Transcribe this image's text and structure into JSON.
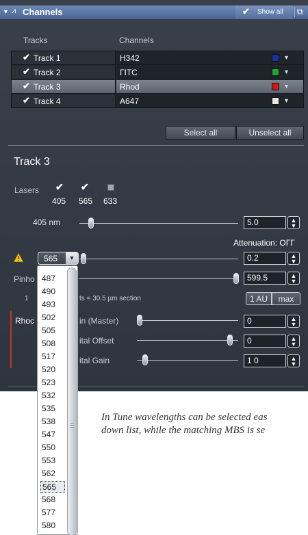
{
  "panel": {
    "title": "Channels",
    "show_all_label": "Show all"
  },
  "tracks_table": {
    "header_tracks": "Tracks",
    "header_channels": "Channels",
    "rows": [
      {
        "track": "Track 1",
        "channel": "H342",
        "color": "#1b2f9e",
        "selected": false
      },
      {
        "track": "Track 2",
        "channel": "ГITC",
        "color": "#1ca63a",
        "selected": false
      },
      {
        "track": "Track 3",
        "channel": "Rhod",
        "color": "#d11818",
        "selected": true
      },
      {
        "track": "Track 4",
        "channel": "A647",
        "color": "#e8e8e8",
        "selected": false
      }
    ]
  },
  "buttons": {
    "select_all": "Select all",
    "unselect_all": "Unselect all"
  },
  "track_section": {
    "title": "Track 3",
    "lasers_label": "Lasers",
    "lasers": [
      {
        "wavelength": "405",
        "checked": true
      },
      {
        "wavelength": "565",
        "checked": true
      },
      {
        "wavelength": "633",
        "checked": false
      }
    ],
    "laser_405_label": "405 nm",
    "laser_405_value": "5.0",
    "attenuation_text": "Attenuation: OГГ",
    "wavelength_combo_value": "565",
    "wavelength_power_value": "0.2",
    "pinhole_label_partial": "Pinho",
    "pinhole_value": "599.5",
    "airy_prefix": "1",
    "airy_text_partial": "ts  =  30.5 µm section",
    "btn_1au": "1 AU",
    "btn_max": "max",
    "channel_label_partial": "Rhoc",
    "gain_label_partial": "in (Master)",
    "gain_value": "0",
    "offset_label_partial": "ital Offset",
    "offset_value": "0",
    "digital_gain_label_partial": "ital Gain",
    "digital_gain_value": "1 0"
  },
  "wavelength_dropdown": {
    "options": [
      "487",
      "490",
      "493",
      "502",
      "505",
      "508",
      "517",
      "520",
      "523",
      "532",
      "535",
      "538",
      "547",
      "550",
      "553",
      "562",
      "565",
      "568",
      "577",
      "580"
    ],
    "selected": "565"
  },
  "caption": {
    "line1": "In Tune wavelengths can be selected eas",
    "line2": "down list, while the matching MBS is se"
  }
}
